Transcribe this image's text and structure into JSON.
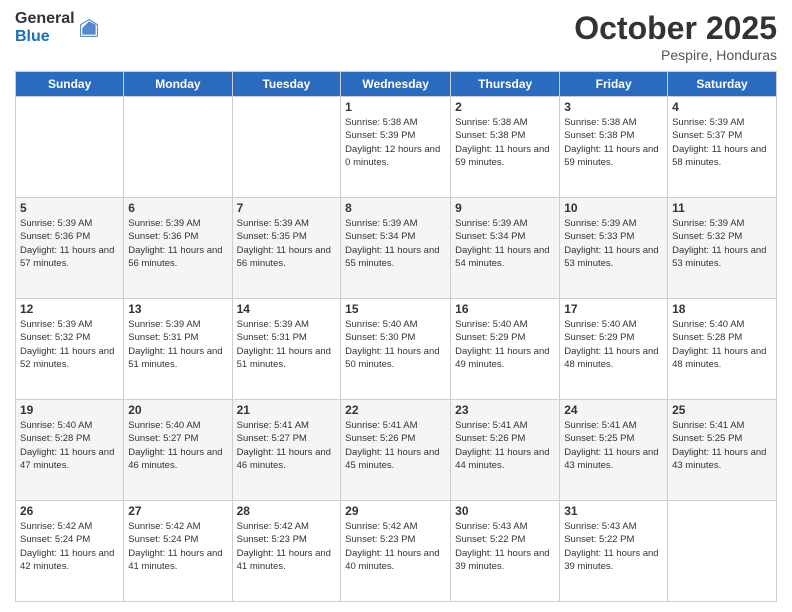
{
  "logo": {
    "general": "General",
    "blue": "Blue"
  },
  "header": {
    "month": "October 2025",
    "location": "Pespire, Honduras"
  },
  "weekdays": [
    "Sunday",
    "Monday",
    "Tuesday",
    "Wednesday",
    "Thursday",
    "Friday",
    "Saturday"
  ],
  "weeks": [
    [
      {
        "day": "",
        "sunrise": "",
        "sunset": "",
        "daylight": ""
      },
      {
        "day": "",
        "sunrise": "",
        "sunset": "",
        "daylight": ""
      },
      {
        "day": "",
        "sunrise": "",
        "sunset": "",
        "daylight": ""
      },
      {
        "day": "1",
        "sunrise": "Sunrise: 5:38 AM",
        "sunset": "Sunset: 5:39 PM",
        "daylight": "Daylight: 12 hours and 0 minutes."
      },
      {
        "day": "2",
        "sunrise": "Sunrise: 5:38 AM",
        "sunset": "Sunset: 5:38 PM",
        "daylight": "Daylight: 11 hours and 59 minutes."
      },
      {
        "day": "3",
        "sunrise": "Sunrise: 5:38 AM",
        "sunset": "Sunset: 5:38 PM",
        "daylight": "Daylight: 11 hours and 59 minutes."
      },
      {
        "day": "4",
        "sunrise": "Sunrise: 5:39 AM",
        "sunset": "Sunset: 5:37 PM",
        "daylight": "Daylight: 11 hours and 58 minutes."
      }
    ],
    [
      {
        "day": "5",
        "sunrise": "Sunrise: 5:39 AM",
        "sunset": "Sunset: 5:36 PM",
        "daylight": "Daylight: 11 hours and 57 minutes."
      },
      {
        "day": "6",
        "sunrise": "Sunrise: 5:39 AM",
        "sunset": "Sunset: 5:36 PM",
        "daylight": "Daylight: 11 hours and 56 minutes."
      },
      {
        "day": "7",
        "sunrise": "Sunrise: 5:39 AM",
        "sunset": "Sunset: 5:35 PM",
        "daylight": "Daylight: 11 hours and 56 minutes."
      },
      {
        "day": "8",
        "sunrise": "Sunrise: 5:39 AM",
        "sunset": "Sunset: 5:34 PM",
        "daylight": "Daylight: 11 hours and 55 minutes."
      },
      {
        "day": "9",
        "sunrise": "Sunrise: 5:39 AM",
        "sunset": "Sunset: 5:34 PM",
        "daylight": "Daylight: 11 hours and 54 minutes."
      },
      {
        "day": "10",
        "sunrise": "Sunrise: 5:39 AM",
        "sunset": "Sunset: 5:33 PM",
        "daylight": "Daylight: 11 hours and 53 minutes."
      },
      {
        "day": "11",
        "sunrise": "Sunrise: 5:39 AM",
        "sunset": "Sunset: 5:32 PM",
        "daylight": "Daylight: 11 hours and 53 minutes."
      }
    ],
    [
      {
        "day": "12",
        "sunrise": "Sunrise: 5:39 AM",
        "sunset": "Sunset: 5:32 PM",
        "daylight": "Daylight: 11 hours and 52 minutes."
      },
      {
        "day": "13",
        "sunrise": "Sunrise: 5:39 AM",
        "sunset": "Sunset: 5:31 PM",
        "daylight": "Daylight: 11 hours and 51 minutes."
      },
      {
        "day": "14",
        "sunrise": "Sunrise: 5:39 AM",
        "sunset": "Sunset: 5:31 PM",
        "daylight": "Daylight: 11 hours and 51 minutes."
      },
      {
        "day": "15",
        "sunrise": "Sunrise: 5:40 AM",
        "sunset": "Sunset: 5:30 PM",
        "daylight": "Daylight: 11 hours and 50 minutes."
      },
      {
        "day": "16",
        "sunrise": "Sunrise: 5:40 AM",
        "sunset": "Sunset: 5:29 PM",
        "daylight": "Daylight: 11 hours and 49 minutes."
      },
      {
        "day": "17",
        "sunrise": "Sunrise: 5:40 AM",
        "sunset": "Sunset: 5:29 PM",
        "daylight": "Daylight: 11 hours and 48 minutes."
      },
      {
        "day": "18",
        "sunrise": "Sunrise: 5:40 AM",
        "sunset": "Sunset: 5:28 PM",
        "daylight": "Daylight: 11 hours and 48 minutes."
      }
    ],
    [
      {
        "day": "19",
        "sunrise": "Sunrise: 5:40 AM",
        "sunset": "Sunset: 5:28 PM",
        "daylight": "Daylight: 11 hours and 47 minutes."
      },
      {
        "day": "20",
        "sunrise": "Sunrise: 5:40 AM",
        "sunset": "Sunset: 5:27 PM",
        "daylight": "Daylight: 11 hours and 46 minutes."
      },
      {
        "day": "21",
        "sunrise": "Sunrise: 5:41 AM",
        "sunset": "Sunset: 5:27 PM",
        "daylight": "Daylight: 11 hours and 46 minutes."
      },
      {
        "day": "22",
        "sunrise": "Sunrise: 5:41 AM",
        "sunset": "Sunset: 5:26 PM",
        "daylight": "Daylight: 11 hours and 45 minutes."
      },
      {
        "day": "23",
        "sunrise": "Sunrise: 5:41 AM",
        "sunset": "Sunset: 5:26 PM",
        "daylight": "Daylight: 11 hours and 44 minutes."
      },
      {
        "day": "24",
        "sunrise": "Sunrise: 5:41 AM",
        "sunset": "Sunset: 5:25 PM",
        "daylight": "Daylight: 11 hours and 43 minutes."
      },
      {
        "day": "25",
        "sunrise": "Sunrise: 5:41 AM",
        "sunset": "Sunset: 5:25 PM",
        "daylight": "Daylight: 11 hours and 43 minutes."
      }
    ],
    [
      {
        "day": "26",
        "sunrise": "Sunrise: 5:42 AM",
        "sunset": "Sunset: 5:24 PM",
        "daylight": "Daylight: 11 hours and 42 minutes."
      },
      {
        "day": "27",
        "sunrise": "Sunrise: 5:42 AM",
        "sunset": "Sunset: 5:24 PM",
        "daylight": "Daylight: 11 hours and 41 minutes."
      },
      {
        "day": "28",
        "sunrise": "Sunrise: 5:42 AM",
        "sunset": "Sunset: 5:23 PM",
        "daylight": "Daylight: 11 hours and 41 minutes."
      },
      {
        "day": "29",
        "sunrise": "Sunrise: 5:42 AM",
        "sunset": "Sunset: 5:23 PM",
        "daylight": "Daylight: 11 hours and 40 minutes."
      },
      {
        "day": "30",
        "sunrise": "Sunrise: 5:43 AM",
        "sunset": "Sunset: 5:22 PM",
        "daylight": "Daylight: 11 hours and 39 minutes."
      },
      {
        "day": "31",
        "sunrise": "Sunrise: 5:43 AM",
        "sunset": "Sunset: 5:22 PM",
        "daylight": "Daylight: 11 hours and 39 minutes."
      },
      {
        "day": "",
        "sunrise": "",
        "sunset": "",
        "daylight": ""
      }
    ]
  ]
}
